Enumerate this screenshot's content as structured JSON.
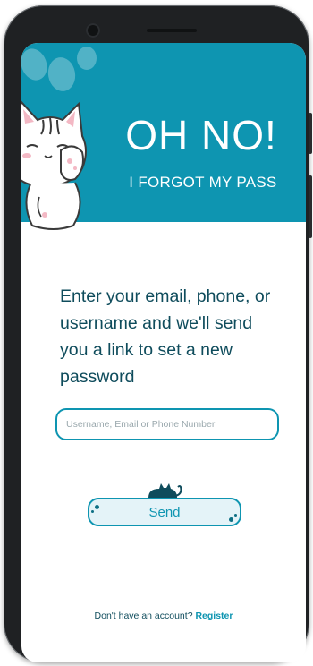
{
  "header": {
    "title": "OH NO!",
    "subtitle": "I FORGOT MY PASS"
  },
  "form": {
    "instructions": "Enter your email, phone, or username and we'll send you a link to set a new password",
    "identifier_placeholder": "Username, Email or Phone Number",
    "identifier_value": "",
    "send_label": "Send"
  },
  "footer": {
    "prompt": "Don't have an account?",
    "register_label": "Register"
  },
  "colors": {
    "accent": "#0e95b1",
    "text": "#0f4c5c",
    "frame": "#1f2123"
  },
  "icons": {
    "header_mascot": "cat-peeking-icon",
    "send_mascot": "cat-sleeping-icon",
    "decor": "paw-prints-icon"
  }
}
